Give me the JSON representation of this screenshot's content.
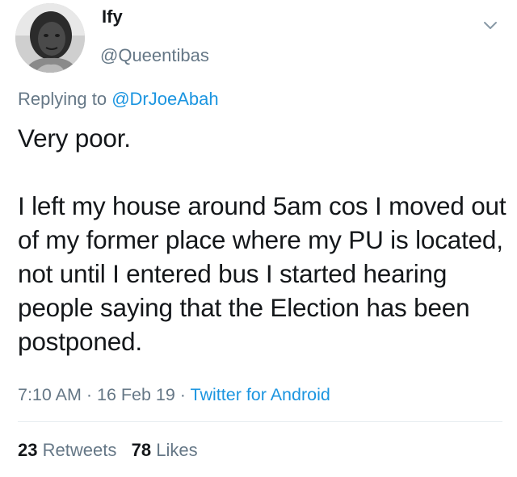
{
  "user": {
    "display_name": "Ify",
    "handle": "@Queentibas"
  },
  "reply": {
    "prefix": "Replying to",
    "to_handle": "@DrJoeAbah"
  },
  "tweet": {
    "text": "Very poor.\n\nI left my house around 5am cos I moved out of my former place where my PU is located, not until I entered bus I started hearing people saying that the Election has been postponed."
  },
  "meta": {
    "time": "7:10 AM",
    "sep1": " · ",
    "date": "16 Feb 19",
    "sep2": " · ",
    "source": "Twitter for Android"
  },
  "stats": {
    "retweets_count": "23",
    "retweets_label": "Retweets",
    "likes_count": "78",
    "likes_label": "Likes"
  },
  "icons": {
    "avatar": "profile-photo",
    "caret": "chevron-down-icon"
  },
  "colors": {
    "text": "#14171a",
    "secondary": "#657786",
    "link": "#1b95e0"
  }
}
